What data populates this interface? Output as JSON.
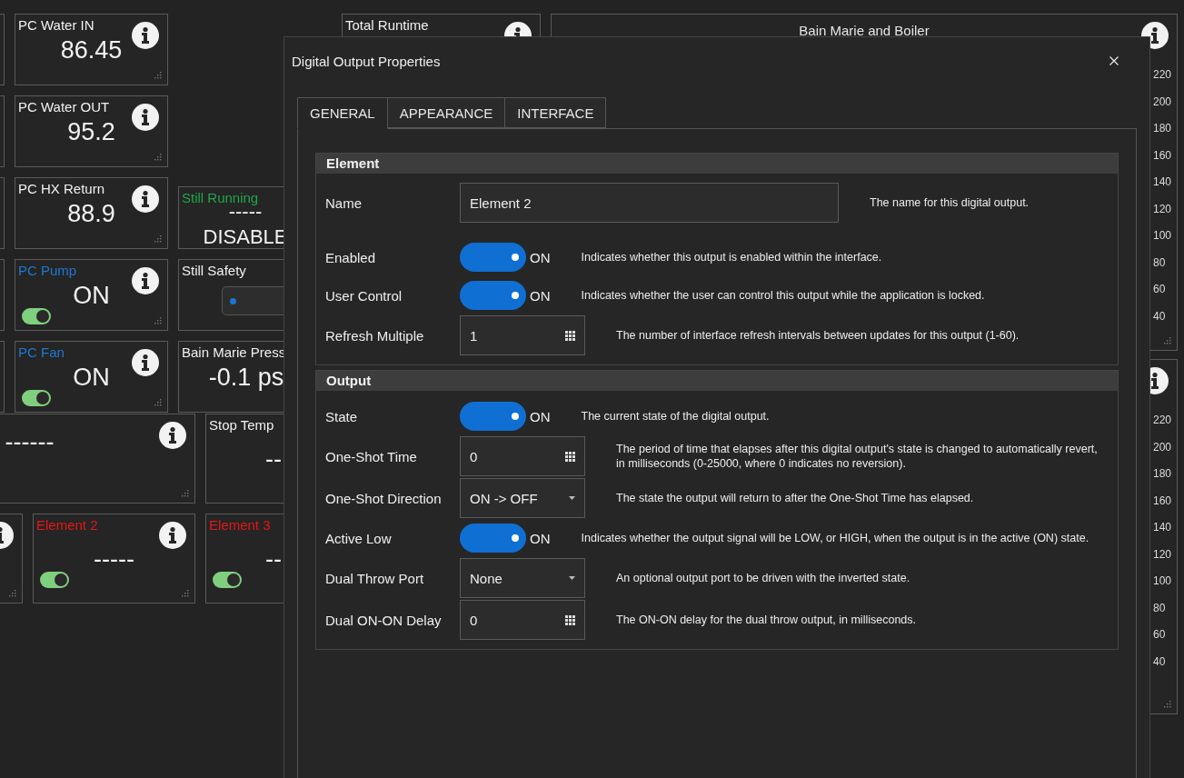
{
  "dashboard": {
    "tiles": [
      {
        "kind": "blank",
        "info": false
      },
      {
        "kind": "blank",
        "info": false
      },
      {
        "kind": "blank",
        "info": false
      },
      {
        "kind": "blank",
        "info": false
      },
      {
        "kind": "blank",
        "info": false
      },
      {
        "kind": "value",
        "title": "PC Water IN",
        "color": "#f0f0f0",
        "values": [
          "86.45"
        ],
        "info": true
      },
      {
        "kind": "value",
        "title": "PC Water OUT",
        "color": "#f0f0f0",
        "values": [
          "95.2"
        ],
        "info": true
      },
      {
        "kind": "value",
        "title": "PC HX Return",
        "color": "#f0f0f0",
        "values": [
          "88.9"
        ],
        "info": true
      },
      {
        "kind": "value",
        "title": "PC Pump",
        "color": "#1f78d1",
        "values": [
          "ON"
        ],
        "info": true,
        "switch_on": true
      },
      {
        "kind": "value",
        "title": "PC Fan",
        "color": "#1f78d1",
        "values": [
          "ON"
        ],
        "info": true,
        "switch_on": true
      },
      {
        "kind": "value",
        "values": [
          "------"
        ],
        "info": true
      },
      {
        "kind": "blank",
        "info": true
      },
      {
        "kind": "value",
        "title": "Element 2",
        "color": "#e81515",
        "values": [
          "-----"
        ],
        "info": true,
        "switch_on": true
      },
      {
        "kind": "value",
        "title": "Still Running",
        "color": "#1fa64a",
        "values": [
          "-----",
          "DISABLE"
        ],
        "info": false
      },
      {
        "kind": "indicator",
        "title": "Still Safety",
        "color": "#f0f0f0",
        "info": false
      },
      {
        "kind": "value",
        "title": "Bain Marie Press",
        "color": "#f0f0f0",
        "values": [
          "-0.1 ps"
        ],
        "info": false
      },
      {
        "kind": "value",
        "title": "Stop Temp",
        "color": "#f0f0f0",
        "values": [
          "--"
        ],
        "info": false
      },
      {
        "kind": "value",
        "title": "Element 3",
        "color": "#e81515",
        "values": [
          "--"
        ],
        "info": false,
        "switch_on": true
      },
      {
        "kind": "value",
        "title": "Total Runtime",
        "color": "#f0f0f0",
        "info": true
      },
      {
        "kind": "chart",
        "title": "Bain Marie and Boiler",
        "axis_labels": [
          "220",
          "200",
          "180",
          "160",
          "140",
          "120",
          "100",
          "80",
          "60",
          "40"
        ],
        "info": true
      },
      {
        "kind": "chart",
        "axis_labels": [
          "220",
          "200",
          "180",
          "160",
          "140",
          "120",
          "100",
          "80",
          "60",
          "40"
        ],
        "info": true
      }
    ]
  },
  "dialog": {
    "title": "Digital Output Properties",
    "tabs": [
      {
        "label": "GENERAL",
        "selected": true
      },
      {
        "label": "APPEARANCE",
        "selected": false
      },
      {
        "label": "INTERFACE",
        "selected": false
      }
    ],
    "sections": [
      {
        "title": "Element",
        "rows": [
          {
            "kind": "text",
            "label": "Name",
            "value": "Element 2",
            "description": "The name for this digital output."
          },
          {
            "kind": "toggle",
            "label": "Enabled",
            "on": true,
            "state_text": "ON",
            "description": "Indicates whether this output is enabled within the interface."
          },
          {
            "kind": "toggle",
            "label": "User Control",
            "on": true,
            "state_text": "ON",
            "description": "Indicates whether the user can control this output while the application is locked."
          },
          {
            "kind": "number",
            "label": "Refresh Multiple",
            "value": "1",
            "description": "The number of interface refresh intervals between updates for this output (1-60)."
          }
        ]
      },
      {
        "title": "Output",
        "rows": [
          {
            "kind": "toggle",
            "label": "State",
            "on": true,
            "state_text": "ON",
            "description": "The current state of the digital output."
          },
          {
            "kind": "number",
            "label": "One-Shot Time",
            "value": "0",
            "description": "The period of time that elapses after this digital output's state is changed to automatically revert, in milliseconds (0-25000, where 0 indicates no reversion)."
          },
          {
            "kind": "dropdown",
            "label": "One-Shot Direction",
            "value": "ON -> OFF",
            "description": "The state the output will return to after the One-Shot Time has elapsed."
          },
          {
            "kind": "toggle",
            "label": "Active Low",
            "on": true,
            "state_text": "ON",
            "description": "Indicates whether the output signal will be LOW, or HIGH, when the output is in the active (ON) state."
          },
          {
            "kind": "dropdown",
            "label": "Dual Throw Port",
            "value": "None",
            "description": "An optional output port to be driven with the inverted state."
          },
          {
            "kind": "number",
            "label": "Dual ON-ON Delay",
            "value": "0",
            "description": "The ON-ON delay for the dual throw output, in milliseconds."
          }
        ]
      }
    ]
  }
}
